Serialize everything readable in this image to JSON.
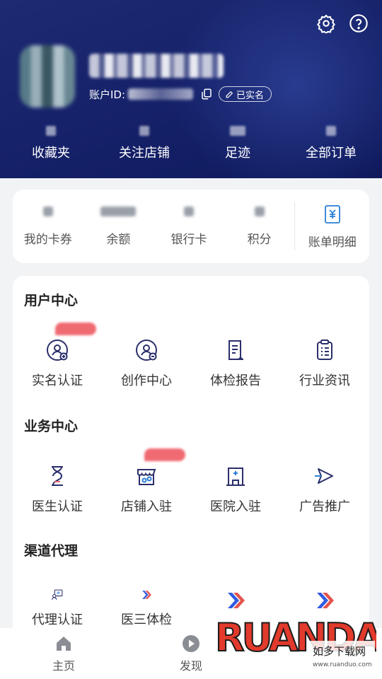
{
  "header": {
    "account_label": "账户ID:",
    "verified_label": "已实名",
    "stats": [
      {
        "label": "收藏夹"
      },
      {
        "label": "关注店铺"
      },
      {
        "label": "足迹"
      },
      {
        "label": "全部订单"
      }
    ]
  },
  "wallet": {
    "items": [
      {
        "label": "我的卡券"
      },
      {
        "label": "余额"
      },
      {
        "label": "银行卡"
      },
      {
        "label": "积分"
      }
    ],
    "bill_label": "账单明细"
  },
  "sections": {
    "user_center": {
      "title": "用户中心",
      "items": [
        {
          "label": "实名认证",
          "icon": "user-verify-icon"
        },
        {
          "label": "创作中心",
          "icon": "creator-icon"
        },
        {
          "label": "体检报告",
          "icon": "report-icon"
        },
        {
          "label": "行业资讯",
          "icon": "news-icon"
        }
      ]
    },
    "business_center": {
      "title": "业务中心",
      "items": [
        {
          "label": "医生认证",
          "icon": "doctor-icon"
        },
        {
          "label": "店铺入驻",
          "icon": "store-icon"
        },
        {
          "label": "医院入驻",
          "icon": "hospital-icon"
        },
        {
          "label": "广告推广",
          "icon": "promote-icon"
        }
      ]
    },
    "channel_agent": {
      "title": "渠道代理",
      "items": [
        {
          "label": "代理认证",
          "icon": "agent-icon"
        },
        {
          "label": "医三体检",
          "icon": "brand-icon"
        },
        {
          "label": "",
          "icon": "brand-icon"
        },
        {
          "label": "",
          "icon": "brand-icon"
        }
      ]
    }
  },
  "bottom_nav": [
    {
      "label": "主页",
      "icon": "home-icon"
    },
    {
      "label": "发现",
      "icon": "play-icon"
    }
  ],
  "watermark": {
    "brand": "RUANDAO",
    "cn": "如多下载网",
    "url": "www.ruanduo.com"
  },
  "colors": {
    "header_bg": "#16226a",
    "accent_blue": "#2f3fa8",
    "badge_red": "#f06a72"
  }
}
